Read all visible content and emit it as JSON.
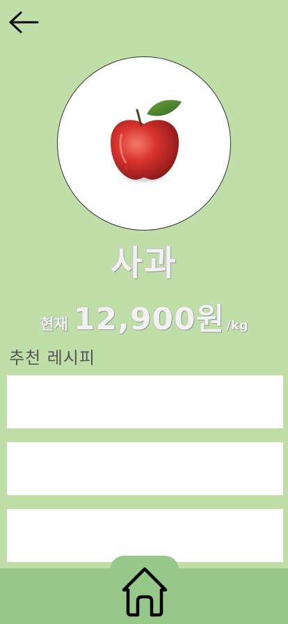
{
  "product": {
    "name": "사과",
    "price_prefix": "현재",
    "price_value": "12,900원",
    "price_unit": "/kg"
  },
  "recipes": {
    "section_title": "추천 레시피",
    "items": [
      "",
      "",
      ""
    ]
  },
  "icons": {
    "back": "arrow-left-icon",
    "home": "home-icon",
    "product_image": "apple"
  },
  "colors": {
    "background": "#c0dea8",
    "bottom_bar": "#96c88a",
    "card": "#ffffff"
  }
}
